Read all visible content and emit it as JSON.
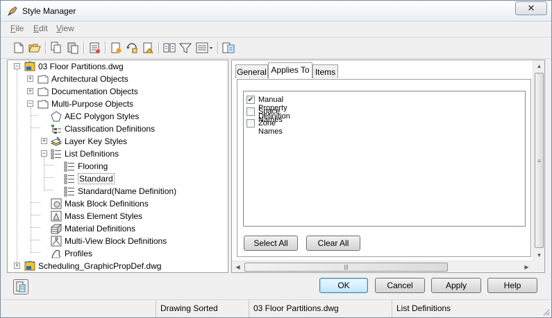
{
  "window": {
    "title": "Style Manager",
    "close_glyph": "✕"
  },
  "menu": [
    {
      "label": "File",
      "key": "F",
      "rest": "ile"
    },
    {
      "label": "Edit",
      "key": "E",
      "rest": "dit"
    },
    {
      "label": "View",
      "key": "V",
      "rest": "iew"
    }
  ],
  "toolbar_icons": [
    "new-drawing-icon",
    "open-drawing-icon",
    "copy-icon",
    "paste-icon",
    "purge-styles-icon",
    "new-style-icon",
    "edit-style-icon",
    "set-from-icon",
    "toggle-view-icon",
    "filter-icon",
    "view-options-icon",
    "inspector-icon"
  ],
  "tree": {
    "drawing1": "03 Floor Partitions.dwg",
    "architectural": "Architectural Objects",
    "documentation": "Documentation Objects",
    "multipurpose": "Multi-Purpose Objects",
    "aec_polygon": "AEC Polygon Styles",
    "classification": "Classification Definitions",
    "layer_key": "Layer Key Styles",
    "list_definitions": "List Definitions",
    "flooring": "Flooring",
    "standard": "Standard",
    "standard_name": "Standard(Name Definition)",
    "mask_block": "Mask Block Definitions",
    "mass_element": "Mass Element Styles",
    "material": "Material Definitions",
    "multiview": "Multi-View Block Definitions",
    "profiles": "Profiles",
    "drawing2": "Scheduling_GraphicPropDef.dwg"
  },
  "tabs": {
    "general": "General",
    "applies_to": "Applies To",
    "items": "Items"
  },
  "applies_list": [
    {
      "label": "Manual Property Definition",
      "checked": true
    },
    {
      "label": "Space Names",
      "checked": false
    },
    {
      "label": "Zone Names",
      "checked": false
    }
  ],
  "buttons": {
    "select_all": "Select All",
    "clear_all": "Clear All",
    "ok": "OK",
    "cancel": "Cancel",
    "apply": "Apply",
    "help": "Help"
  },
  "status": {
    "sort": "Drawing Sorted",
    "drawing": "03 Floor Partitions.dwg",
    "selection": "List Definitions"
  },
  "colors": {
    "check": "#2b6a2b",
    "drawing_icon_yellow": "#f2c230",
    "drawing_icon_blue": "#2f6db5"
  }
}
